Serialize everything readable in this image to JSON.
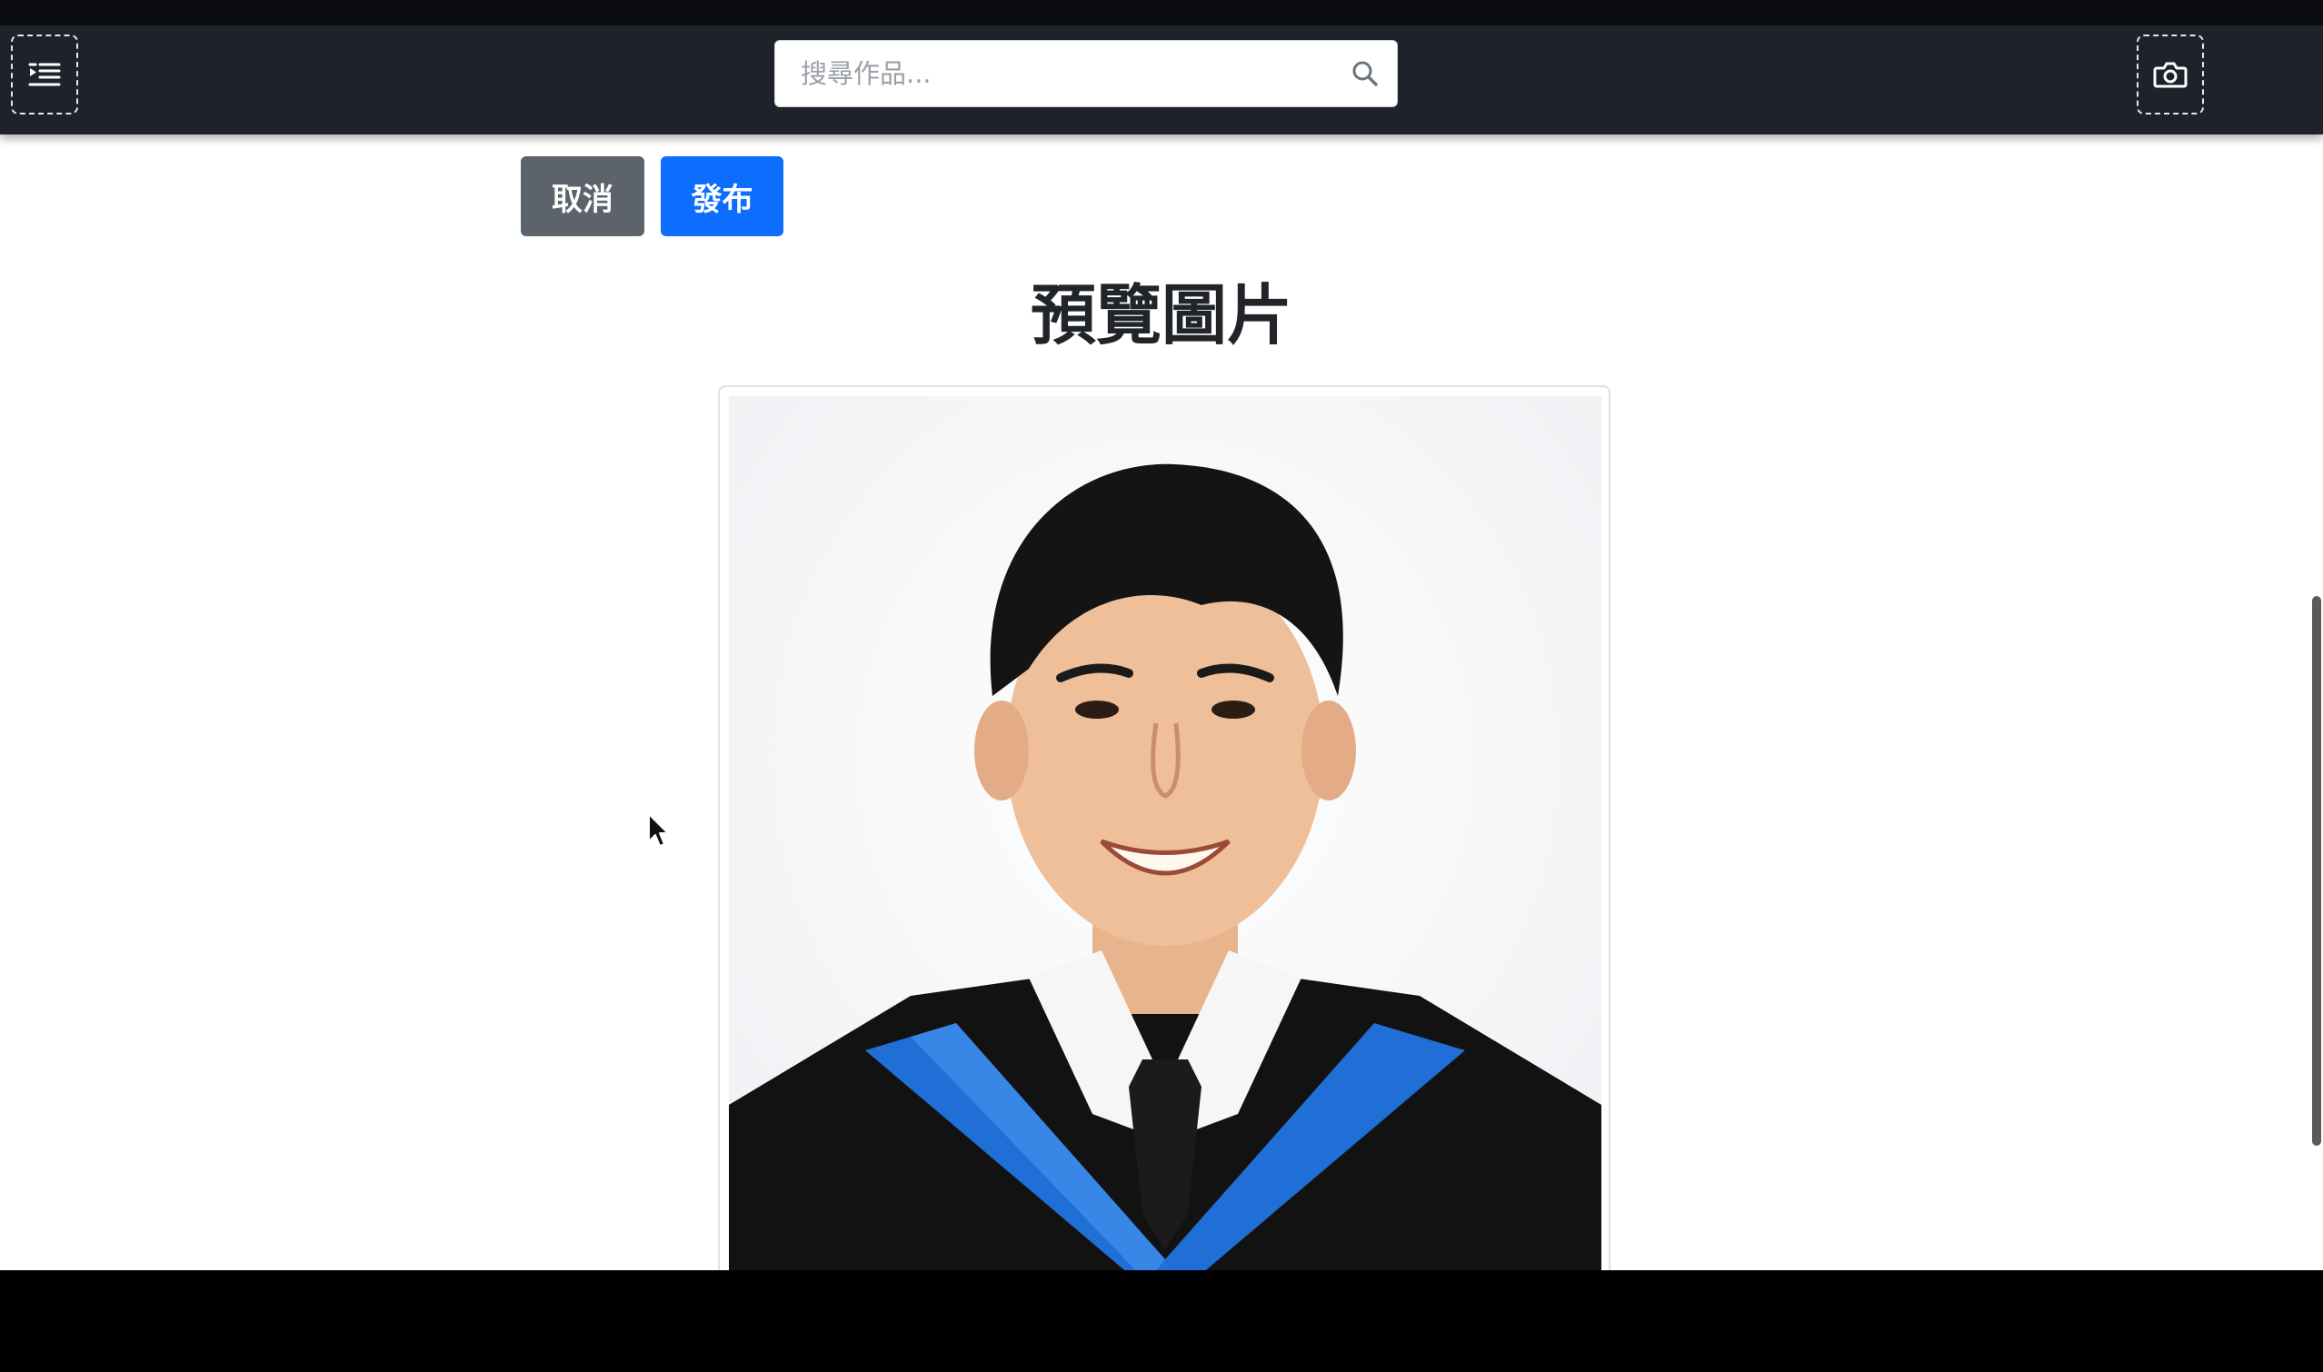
{
  "navbar": {
    "menu_icon": "menu-indent-icon",
    "search": {
      "placeholder": "搜尋作品...",
      "value": "",
      "icon": "search-icon"
    },
    "camera_icon": "camera-icon",
    "background_color": "#1e222a"
  },
  "actions": {
    "cancel_label": "取消",
    "cancel_color": "#5c636a",
    "publish_label": "發布",
    "publish_color": "#0d6efd"
  },
  "preview": {
    "title": "預覽圖片"
  }
}
